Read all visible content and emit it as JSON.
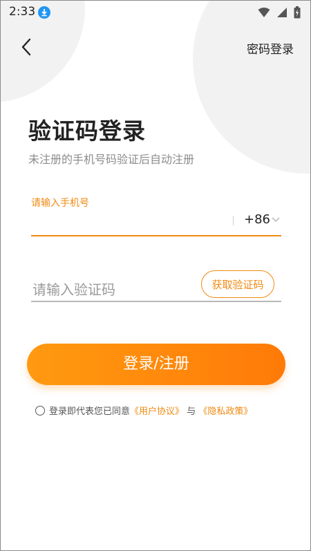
{
  "status_bar": {
    "time": "2:33"
  },
  "header": {
    "password_login": "密码登录"
  },
  "title": "验证码登录",
  "subtitle": "未注册的手机号码验证后自动注册",
  "phone": {
    "label": "请输入手机号",
    "value": "",
    "country_code": "+86"
  },
  "code": {
    "placeholder": "请输入验证码",
    "get_code_label": "获取验证码"
  },
  "login_button": "登录/注册",
  "agreement": {
    "prefix": "登录即代表您已同意",
    "user_agreement": "《用户协议》",
    "and": "与",
    "privacy_policy": "《隐私政策》"
  },
  "colors": {
    "accent": "#f08a12",
    "button_start": "#ff9a10",
    "button_end": "#ff7a08"
  }
}
